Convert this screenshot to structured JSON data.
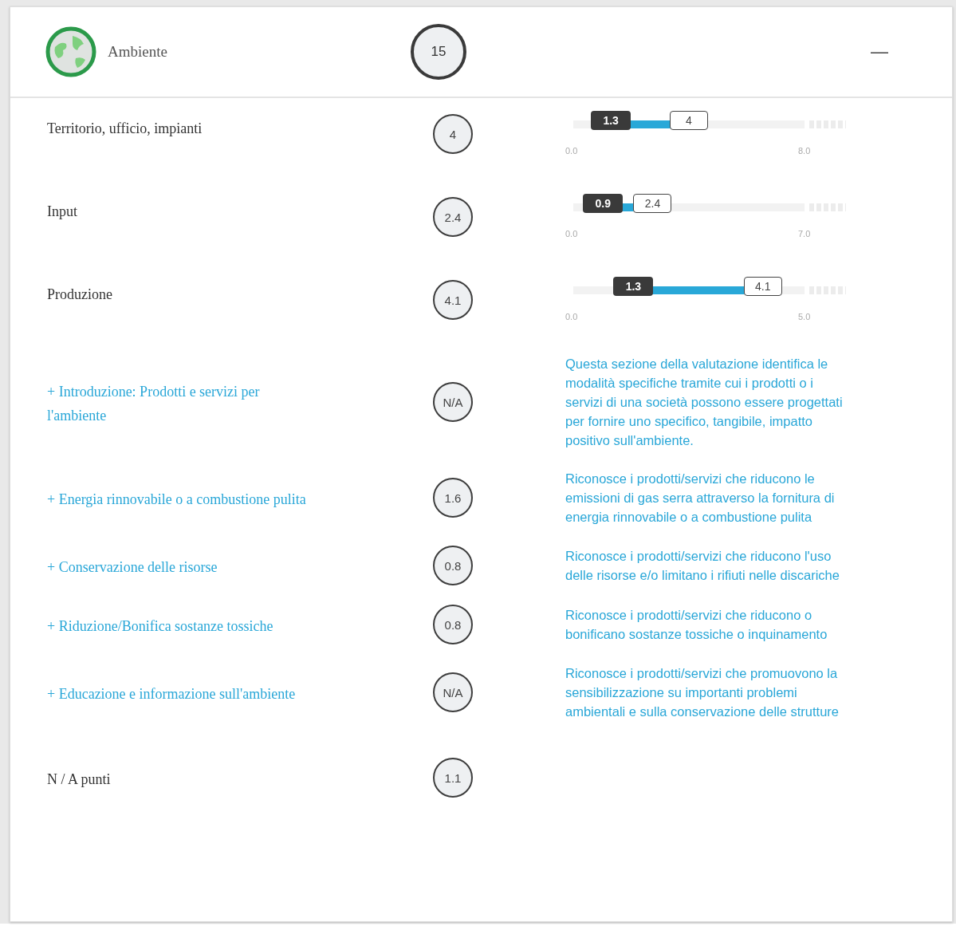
{
  "header": {
    "title": "Ambiente",
    "score": "15",
    "toggle": "—"
  },
  "rows": [
    {
      "kind": "slider",
      "label": "Territorio, ufficio, impianti",
      "score": "4",
      "thumbs": [
        {
          "label": "1.3",
          "level": 0.1625
        },
        {
          "label": "4",
          "level": 0.5
        }
      ],
      "min": "0.0",
      "max": "8.0"
    },
    {
      "kind": "slider",
      "label": "Input",
      "score": "2.4",
      "thumbs": [
        {
          "label": "0.9",
          "level": 0.1286
        },
        {
          "label": "2.4",
          "level": 0.3429
        }
      ],
      "min": "0.0",
      "max": "7.0"
    },
    {
      "kind": "slider",
      "label": "Produzione",
      "score": "4.1",
      "thumbs": [
        {
          "label": "1.3",
          "level": 0.26
        },
        {
          "label": "4.1",
          "level": 0.82
        }
      ],
      "min": "0.0",
      "max": "5.0"
    },
    {
      "kind": "link",
      "label": "+ Introduzione: Prodotti e servizi per l'ambiente",
      "score": "N/A",
      "description": "Questa sezione della valutazione identifica le modalità specifiche tramite cui i prodotti o i servizi di una società possono essere progettati per fornire uno specifico, tangibile, impatto positivo sull'ambiente."
    },
    {
      "kind": "link",
      "label": "+ Energia rinnovabile o a combustione pulita",
      "score": "1.6",
      "description": "Riconosce i prodotti/servizi che riducono le emissioni di gas serra attraverso la fornitura di energia rinnovabile o a combustione pulita"
    },
    {
      "kind": "link",
      "label": "+ Conservazione delle risorse",
      "score": "0.8",
      "description": "Riconosce i prodotti/servizi che riducono l'uso delle risorse e/o limitano i rifiuti nelle discariche"
    },
    {
      "kind": "link",
      "label": "+ Riduzione/Bonifica sostanze tossiche",
      "score": "0.8",
      "description": "Riconosce i prodotti/servizi che riducono o bonificano sostanze tossiche o inquinamento"
    },
    {
      "kind": "link",
      "label": "+ Educazione e informazione sull'ambiente",
      "score": "N/A",
      "description": "Riconosce i prodotti/servizi che promuovono la sensibilizzazione su importanti problemi ambientali e sulla conservazione delle strutture"
    },
    {
      "kind": "plain",
      "label": "N / A punti",
      "score": "1.1"
    }
  ]
}
